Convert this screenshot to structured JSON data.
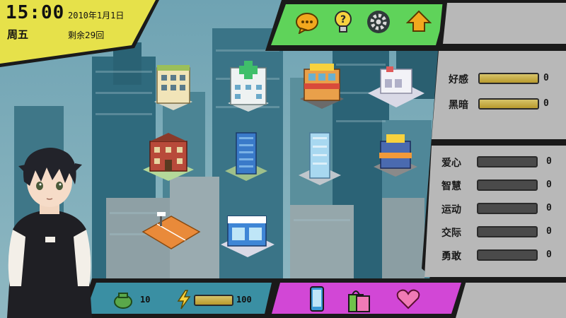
{
  "clock": {
    "time": "15:00",
    "date": "2010年1月1日",
    "weekday": "周五",
    "remaining": "剩余29回"
  },
  "top_menu": [
    "chat-bubble-icon",
    "hint-lightbulb-icon",
    "settings-gear-icon",
    "home-up-arrow-icon"
  ],
  "relations": [
    {
      "label": "好感",
      "value": "0",
      "fill_percent": 100
    },
    {
      "label": "黑暗",
      "value": "0",
      "fill_percent": 100
    }
  ],
  "attributes": [
    {
      "label": "爱心",
      "value": "0",
      "fill_percent": 0
    },
    {
      "label": "智慧",
      "value": "0",
      "fill_percent": 0
    },
    {
      "label": "运动",
      "value": "0",
      "fill_percent": 0
    },
    {
      "label": "交际",
      "value": "0",
      "fill_percent": 0
    },
    {
      "label": "勇敢",
      "value": "0",
      "fill_percent": 0
    }
  ],
  "resources": {
    "money": "10",
    "energy": "100",
    "energy_fill_percent": 100
  },
  "bottom_menu": [
    "phone-icon",
    "shopping-bag-icon",
    "heart-icon"
  ],
  "buildings": [
    "apartment",
    "hospital",
    "restaurant",
    "warehouse",
    "school",
    "office-tower",
    "skyscraper",
    "shop",
    "basketball-court",
    "convenience-store"
  ],
  "colors": {
    "yellow": "#e6e14a",
    "green": "#5fd35a",
    "magenta": "#d247d6",
    "teal": "#3a8fa3",
    "gray": "#b8b8b8"
  }
}
